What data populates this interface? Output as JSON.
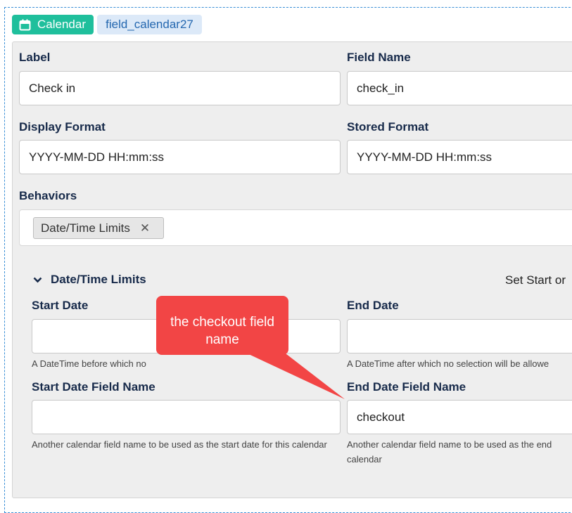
{
  "header": {
    "type_badge": "Calendar",
    "field_id_badge": "field_calendar27"
  },
  "form": {
    "label": {
      "title": "Label",
      "value": "Check in"
    },
    "field_name": {
      "title": "Field Name",
      "value": "check_in"
    },
    "display_format": {
      "title": "Display Format",
      "value": "YYYY-MM-DD HH:mm:ss"
    },
    "stored_format": {
      "title": "Stored Format",
      "value": "YYYY-MM-DD HH:mm:ss"
    },
    "behaviors": {
      "title": "Behaviors",
      "chips": [
        "Date/Time Limits"
      ]
    }
  },
  "limits": {
    "section_title": "Date/Time Limits",
    "right_note": "Set Start or",
    "start_date": {
      "title": "Start Date",
      "value": "",
      "help": "A DateTime before which no"
    },
    "end_date": {
      "title": "End Date",
      "value": "",
      "help": "A DateTime after which no selection will be allowe"
    },
    "start_field": {
      "title": "Start Date Field Name",
      "value": "",
      "help": "Another calendar field name to be used as the start date for this calendar"
    },
    "end_field": {
      "title": "End Date Field Name",
      "value": "checkout",
      "help": "Another calendar field name to be used as the end calendar"
    }
  },
  "annotation": {
    "text": "the checkout field name"
  },
  "colors": {
    "accent_teal": "#1fbf9c",
    "callout_red": "#f24545",
    "dash_blue": "#3a8fd6"
  }
}
